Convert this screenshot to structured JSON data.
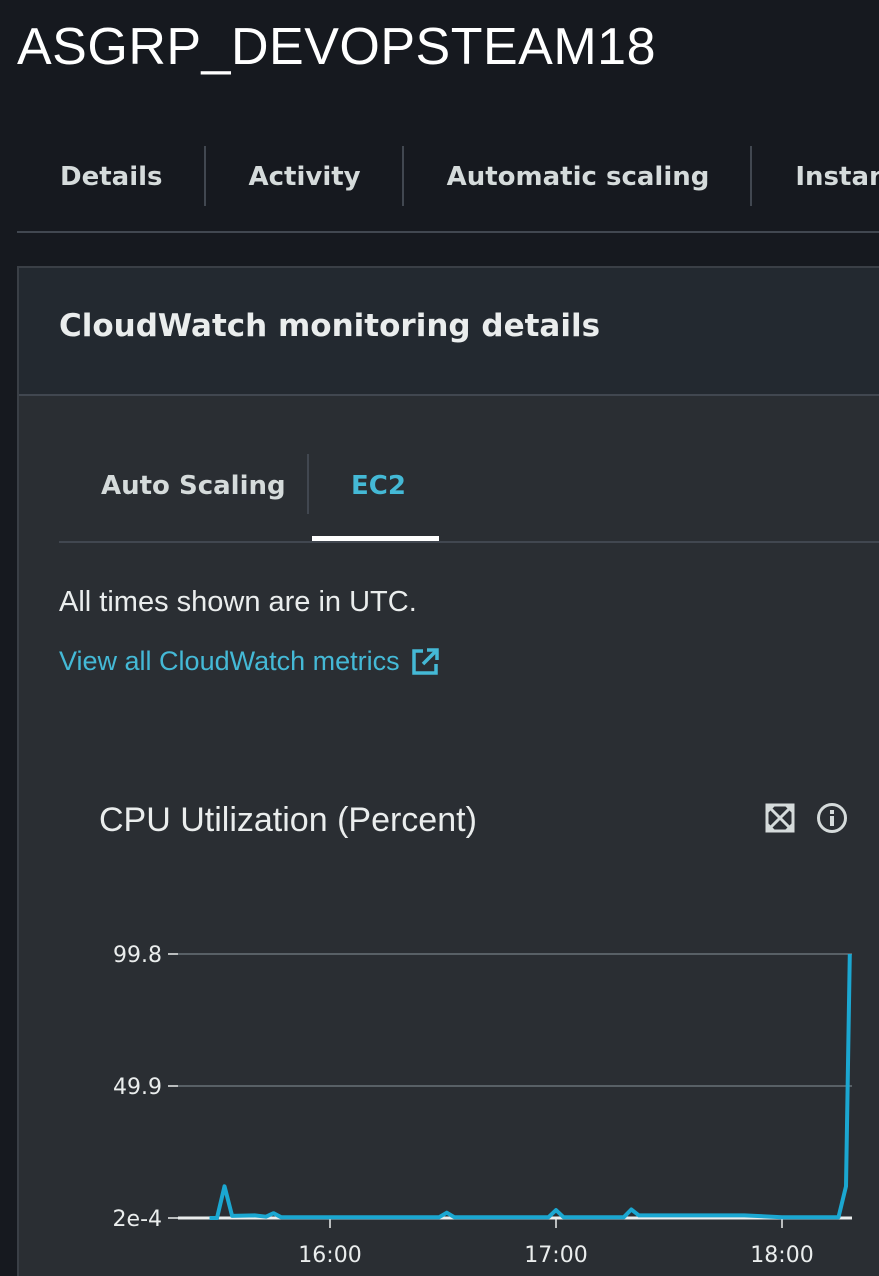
{
  "page": {
    "title": "ASGRP_DEVOPSTEAM18"
  },
  "tabs": [
    {
      "label": "Details"
    },
    {
      "label": "Activity"
    },
    {
      "label": "Automatic scaling"
    },
    {
      "label": "Instance m"
    }
  ],
  "panel": {
    "title": "CloudWatch monitoring details",
    "subtabs": [
      {
        "label": "Auto Scaling",
        "selected": false
      },
      {
        "label": "EC2",
        "selected": true
      }
    ],
    "utc_note": "All times shown are in UTC.",
    "metrics_link": "View all CloudWatch metrics",
    "link_icon": "external-link-icon"
  },
  "widget": {
    "title": "CPU Utilization (Percent)",
    "icons": [
      "expand-icon",
      "info-icon"
    ]
  },
  "colors": {
    "background": "#16191f",
    "panel": "#2a2e33",
    "accent": "#44b9d6",
    "series": "#1ba7d1"
  },
  "chart_data": {
    "type": "line",
    "title": "CPU Utilization (Percent)",
    "xlabel": "",
    "ylabel": "",
    "ylim": [
      0.0002,
      99.8
    ],
    "yticks": [
      "99.8",
      "49.9",
      "2e-4"
    ],
    "ytick_values": [
      99.8,
      49.9,
      0.0002
    ],
    "xticks": [
      "16:00",
      "17:00",
      "18:00"
    ],
    "xtick_minutes": [
      960,
      1020,
      1080
    ],
    "grid": true,
    "legend": "none",
    "series": [
      {
        "x": [
          "15:28",
          "15:30",
          "15:32",
          "15:34",
          "15:40",
          "15:43",
          "15:45",
          "15:47",
          "15:55",
          "16:05",
          "16:15",
          "16:29",
          "16:31",
          "16:33",
          "16:45",
          "16:58",
          "17:00",
          "17:02",
          "17:10",
          "17:18",
          "17:20",
          "17:22",
          "17:30",
          "17:45",
          "17:50",
          "18:00",
          "18:10",
          "18:15",
          "18:17",
          "18:18"
        ],
        "y": [
          0.0002,
          0.0002,
          12,
          0.8,
          1.0,
          0.5,
          1.8,
          0.3,
          0.3,
          0.3,
          0.3,
          0.3,
          2.0,
          0.3,
          0.3,
          0.3,
          3.0,
          0.3,
          0.3,
          0.3,
          3.2,
          1.0,
          1.0,
          1.0,
          1.0,
          0.3,
          0.3,
          0.3,
          12,
          99.8
        ]
      }
    ]
  }
}
